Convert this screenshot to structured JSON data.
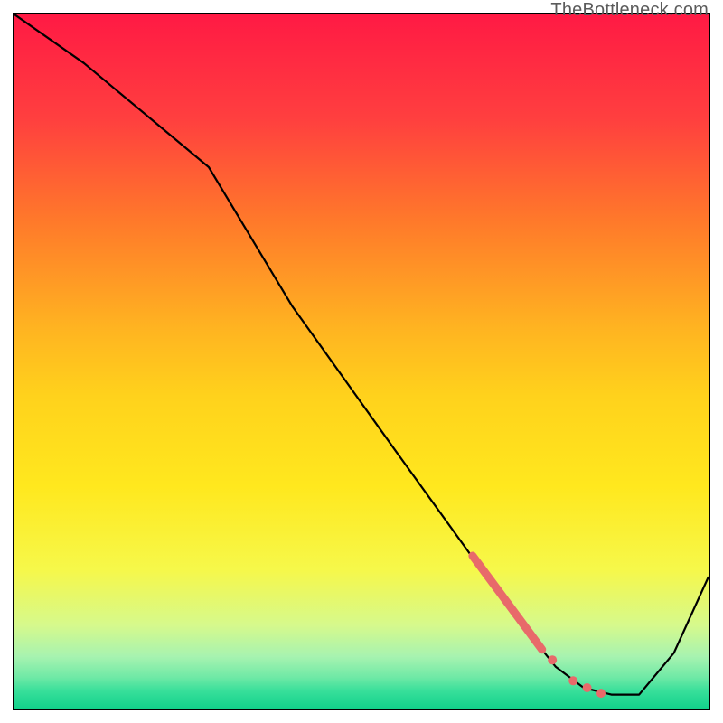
{
  "watermark": "TheBottleneck.com",
  "chart_data": {
    "type": "line",
    "title": "",
    "xlabel": "",
    "ylabel": "",
    "xlim": [
      0,
      100
    ],
    "ylim": [
      0,
      100
    ],
    "grid": false,
    "legend": false,
    "background": {
      "type": "vertical-gradient",
      "stops": [
        {
          "pos": 0.0,
          "color": "#ff1a44"
        },
        {
          "pos": 0.15,
          "color": "#ff3f3f"
        },
        {
          "pos": 0.3,
          "color": "#ff7a2a"
        },
        {
          "pos": 0.45,
          "color": "#ffb321"
        },
        {
          "pos": 0.55,
          "color": "#ffd21c"
        },
        {
          "pos": 0.68,
          "color": "#ffe81e"
        },
        {
          "pos": 0.8,
          "color": "#f6f84a"
        },
        {
          "pos": 0.88,
          "color": "#d6f98c"
        },
        {
          "pos": 0.925,
          "color": "#a7f3b0"
        },
        {
          "pos": 0.955,
          "color": "#6fe9a6"
        },
        {
          "pos": 0.975,
          "color": "#37df9a"
        },
        {
          "pos": 1.0,
          "color": "#12d18b"
        }
      ]
    },
    "series": [
      {
        "name": "bottleneck-curve",
        "color": "#000000",
        "width": 2.2,
        "x": [
          0,
          10,
          22,
          28,
          40,
          55,
          68,
          74,
          78,
          82,
          86,
          90,
          95,
          100
        ],
        "y": [
          100,
          93,
          83,
          78,
          58,
          37,
          19,
          11,
          6,
          3,
          2,
          2,
          8,
          19
        ]
      }
    ],
    "highlight_segments": [
      {
        "name": "dense-segment",
        "color": "#e86a6a",
        "width": 9,
        "x": [
          66,
          76
        ],
        "y": [
          22,
          8.5
        ]
      }
    ],
    "highlight_points": [
      {
        "x": 77.5,
        "y": 7,
        "r": 5,
        "color": "#e86a6a"
      },
      {
        "x": 80.5,
        "y": 4,
        "r": 5,
        "color": "#e86a6a"
      },
      {
        "x": 82.5,
        "y": 3,
        "r": 5,
        "color": "#e86a6a"
      },
      {
        "x": 84.5,
        "y": 2.2,
        "r": 5,
        "color": "#e86a6a"
      }
    ]
  }
}
